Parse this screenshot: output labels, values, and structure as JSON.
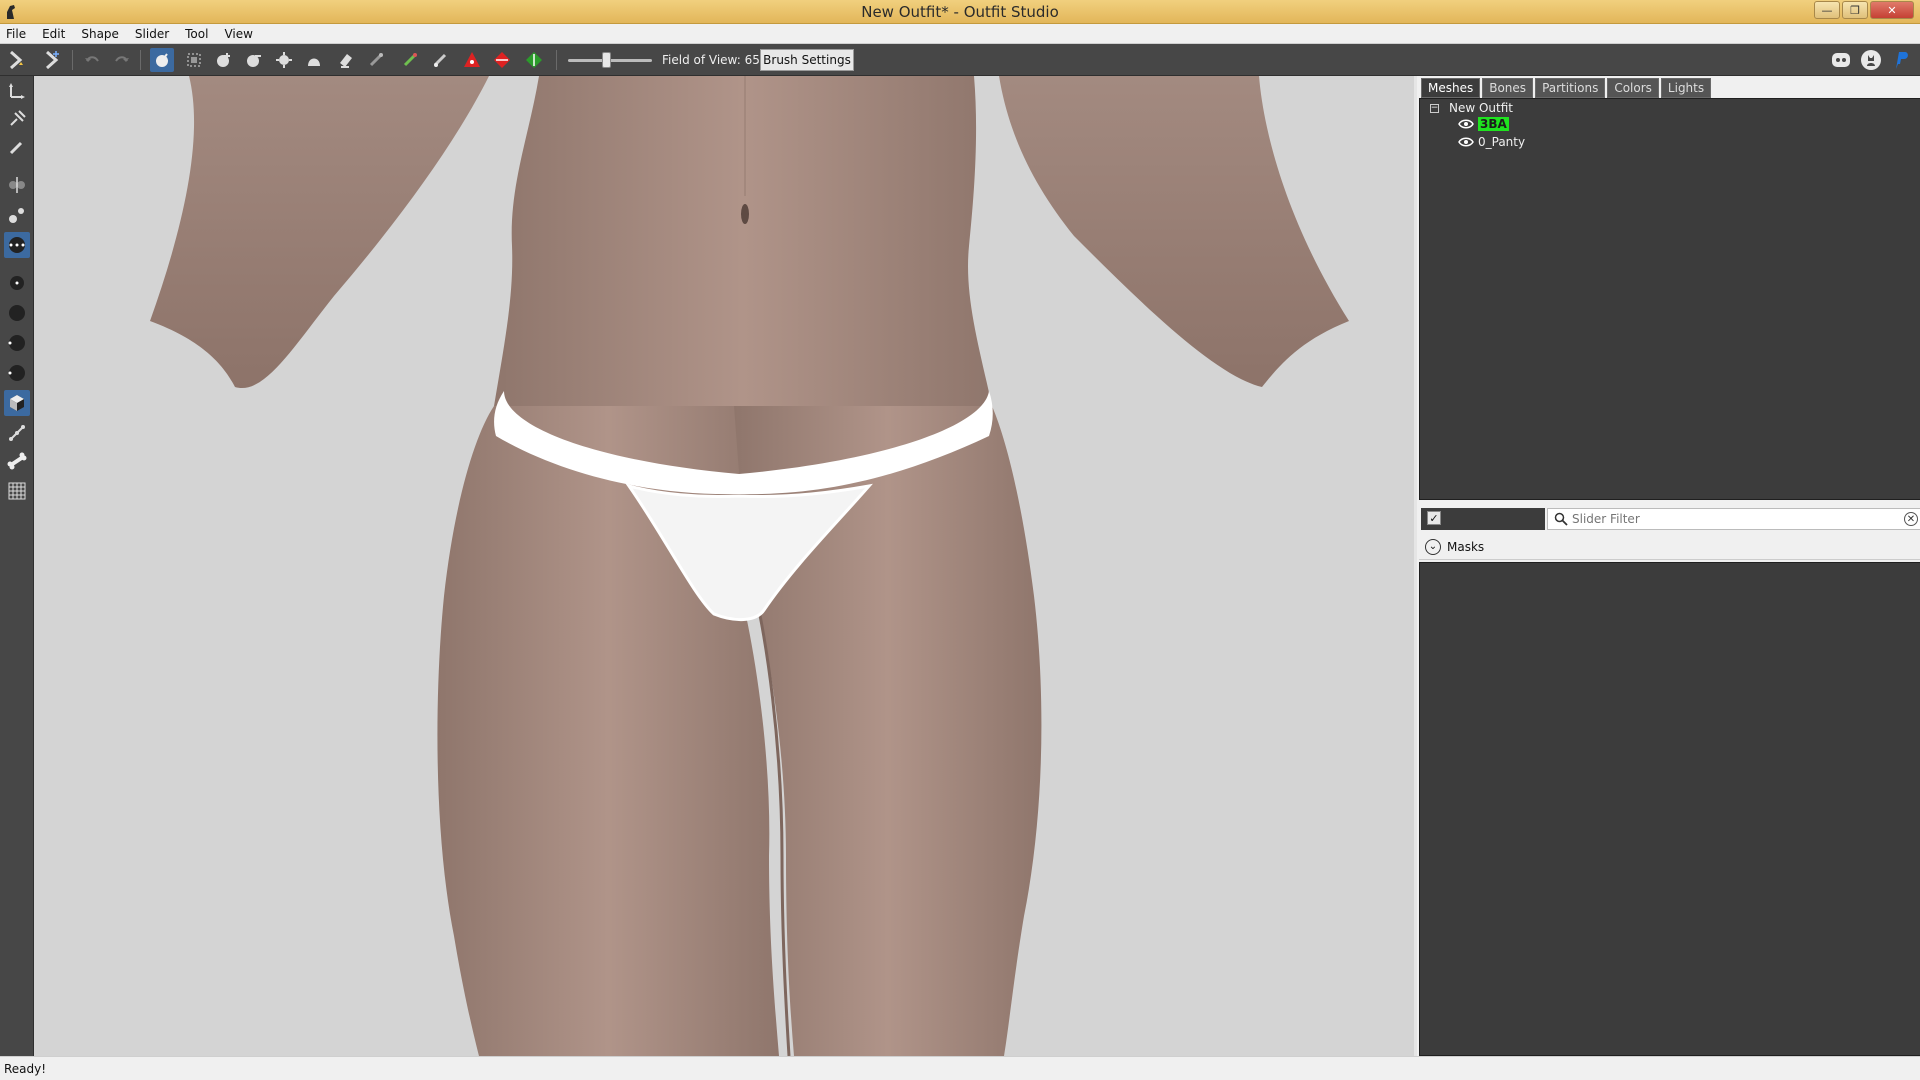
{
  "window": {
    "title": "New Outfit* - Outfit Studio",
    "controls": [
      "minimize",
      "restore",
      "close"
    ],
    "title_bar_color": "#e8c46c",
    "close_color": "#c54034"
  },
  "menu": [
    "File",
    "Edit",
    "Shape",
    "Slider",
    "Tool",
    "View"
  ],
  "toolbar": {
    "fov_label": "Field of View: 65",
    "fov_value": 65,
    "brush_settings_label": "Brush Settings",
    "tools": [
      "new-project-icon",
      "load-reference-icon",
      "undo-icon",
      "redo-icon",
      "select-tool-icon",
      "mask-select-icon",
      "inflate-brush-icon",
      "deflate-brush-icon",
      "move-brush-icon",
      "smooth-brush-icon",
      "undiff-brush-icon",
      "erase-icon",
      "weight-brush-icon",
      "color-brush-icon",
      "alpha-brush-icon",
      "axis-red-icon",
      "axis-diamond-icon",
      "axis-green-icon"
    ],
    "right_icons": [
      "discord-icon",
      "github-icon",
      "paypal-icon"
    ],
    "accent": "#3c6aa0"
  },
  "left_tools": [
    "transform-icon",
    "pivot-icon",
    "pencil-icon",
    "mirror-icon",
    "vertex-select-icon",
    "vertex-points-icon",
    "brush-size-1-icon",
    "brush-size-2-icon",
    "brush-size-3-icon",
    "brush-size-4-icon",
    "cube-icon",
    "bone-pose-icon",
    "bone-icon",
    "wireframe-icon"
  ],
  "panel": {
    "tabs": [
      "Meshes",
      "Bones",
      "Partitions",
      "Colors",
      "Lights"
    ],
    "active_tab": "Meshes",
    "tree": {
      "root": "New Outfit",
      "children": [
        "3BA",
        "0_Panty"
      ],
      "highlight_color": "#1fe31f"
    },
    "slider_filter_placeholder": "Slider Filter",
    "masks_label": "Masks"
  },
  "status": "Ready!",
  "viewport": {
    "background": "#d4d4d4",
    "skin_color": "#a58b80",
    "garment_color": "#ffffff"
  }
}
